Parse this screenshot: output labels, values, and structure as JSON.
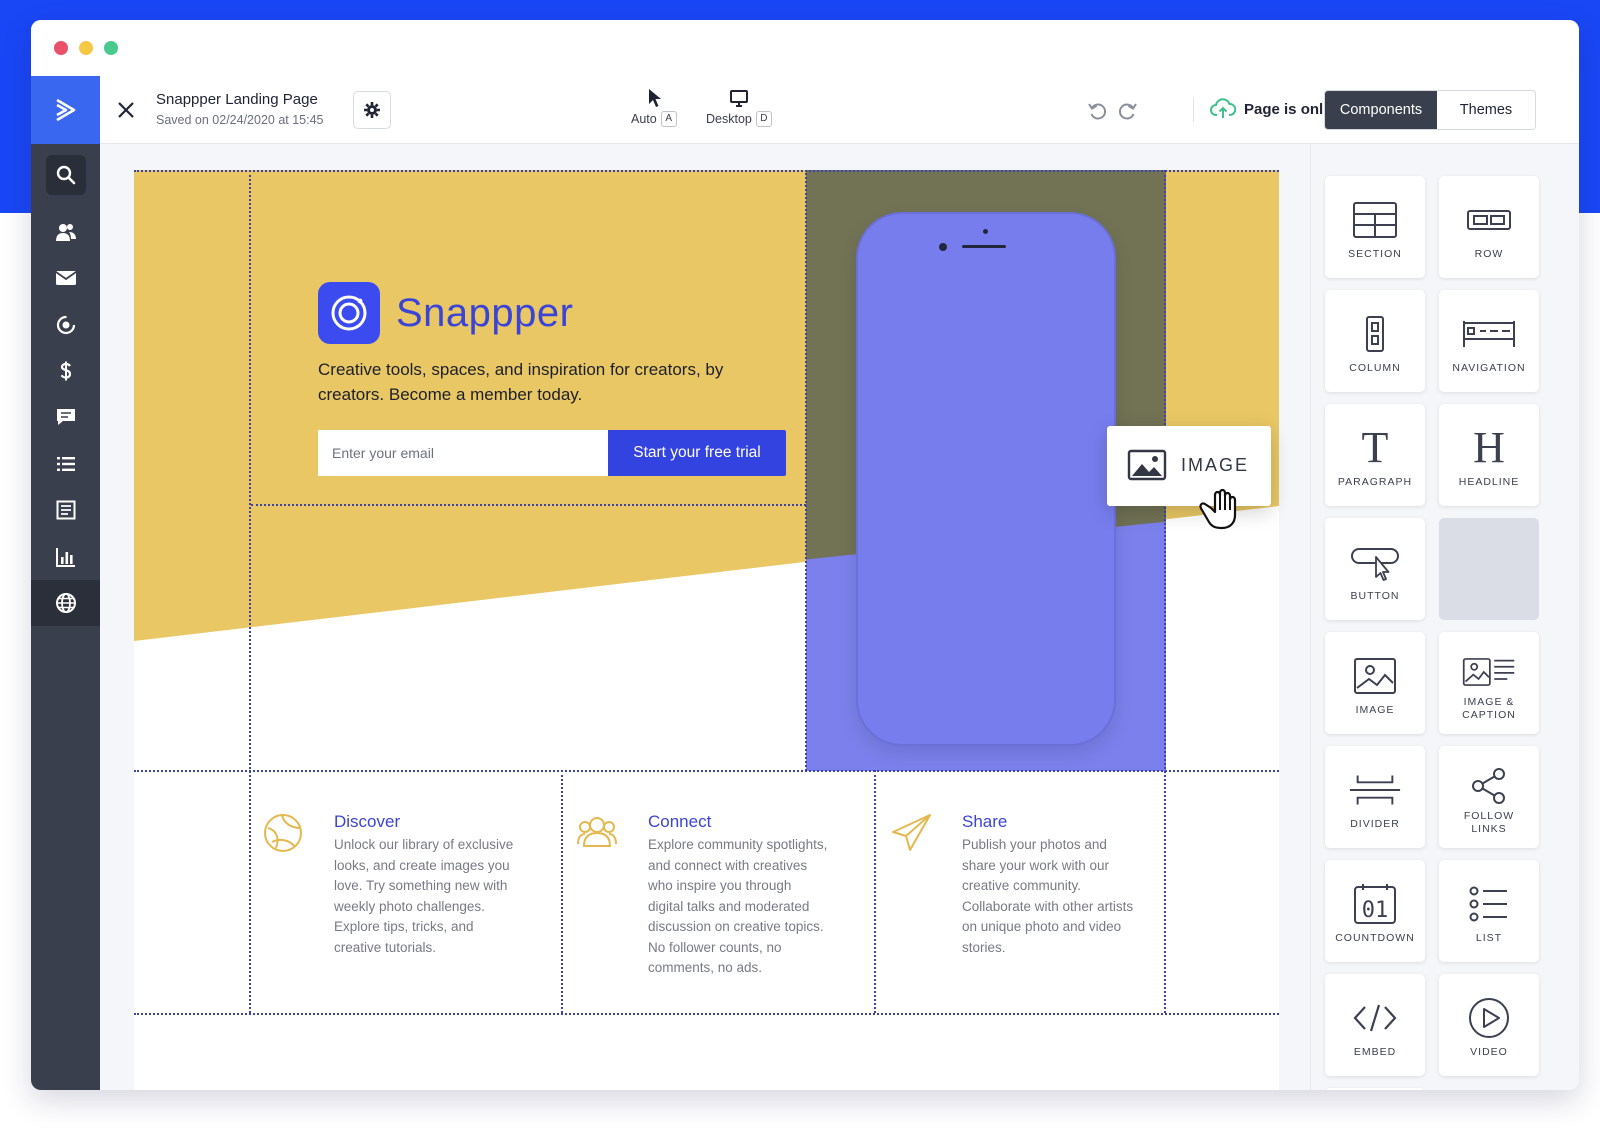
{
  "toolbar": {
    "doc_title": "Snappper Landing Page",
    "saved_text": "Saved on 02/24/2020 at 15:45",
    "mode_auto_label": "Auto",
    "mode_auto_key": "A",
    "mode_desktop_label": "Desktop",
    "mode_desktop_key": "D",
    "status_text": "Page is online",
    "tabs": [
      {
        "label": "Components",
        "active": true
      },
      {
        "label": "Themes",
        "active": false
      }
    ]
  },
  "sidebar": {
    "items": [
      {
        "icon": "search-icon"
      },
      {
        "icon": "contacts-icon"
      },
      {
        "icon": "mail-icon"
      },
      {
        "icon": "automation-icon"
      },
      {
        "icon": "dollar-icon"
      },
      {
        "icon": "chat-icon"
      },
      {
        "icon": "list-icon"
      },
      {
        "icon": "document-icon"
      },
      {
        "icon": "chart-icon"
      },
      {
        "icon": "globe-icon",
        "active": true
      }
    ]
  },
  "hero": {
    "brand_name": "Snappper",
    "tagline": "Creative tools, spaces, and inspiration for creators, by creators. Become a member today.",
    "email_placeholder": "Enter your email",
    "cta_label": "Start your free trial"
  },
  "features": [
    {
      "icon": "globe-outline-icon",
      "title": "Discover",
      "text": "Unlock our library of exclusive looks, and create images you love. Try something new with weekly photo challenges. Explore tips, tricks, and creative tutorials."
    },
    {
      "icon": "people-icon",
      "title": "Connect",
      "text": "Explore community spotlights, and connect with creatives who inspire you through digital talks and moderated discussion on creative topics. No follower counts, no comments, no ads."
    },
    {
      "icon": "paper-plane-icon",
      "title": "Share",
      "text": "Publish your photos and share your work with our creative community. Collaborate with other artists on unique photo and video stories."
    }
  ],
  "drag_card": {
    "label": "IMAGE"
  },
  "components": [
    {
      "label": "SECTION"
    },
    {
      "label": "ROW"
    },
    {
      "label": "COLUMN"
    },
    {
      "label": "NAVIGATION"
    },
    {
      "label": "PARAGRAPH"
    },
    {
      "label": "HEADLINE"
    },
    {
      "label": "BUTTON"
    },
    {
      "label": ""
    },
    {
      "label": "IMAGE"
    },
    {
      "label": "IMAGE & CAPTION"
    },
    {
      "label": "DIVIDER"
    },
    {
      "label": "FOLLOW LINKS"
    },
    {
      "label": "COUNTDOWN"
    },
    {
      "label": "LIST"
    },
    {
      "label": "EMBED"
    },
    {
      "label": "VIDEO"
    }
  ],
  "colors": {
    "brand_blue": "#1a47f5",
    "sidebar_dark": "#3a3f4d",
    "hero_yellow": "#e8c764",
    "phone_purple": "#7b80ec",
    "cta_blue": "#3343e0",
    "feature_title": "#3b44d8"
  }
}
